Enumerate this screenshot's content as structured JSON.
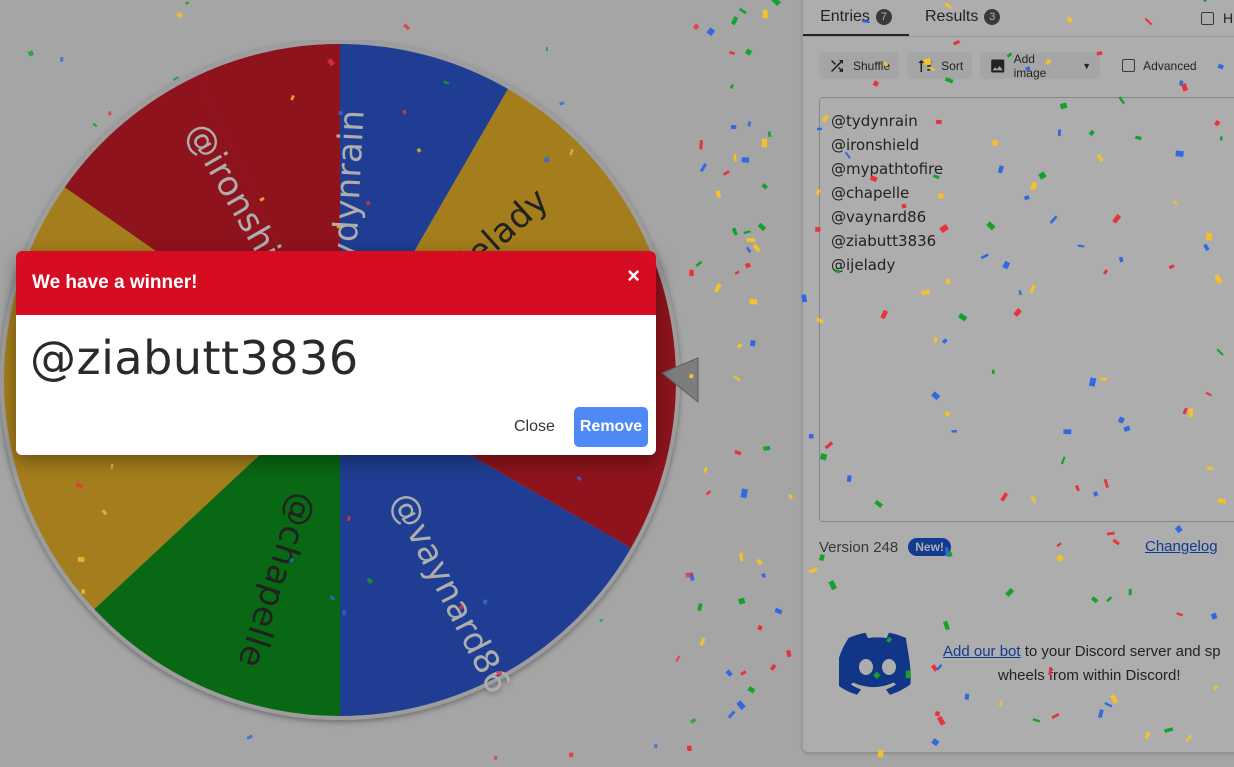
{
  "tabs": [
    {
      "label": "Entries",
      "count": "7"
    },
    {
      "label": "Results",
      "count": "3"
    }
  ],
  "hide_label": "H",
  "toolbar": {
    "shuffle": "Shuffle",
    "sort": "Sort",
    "add_image": "Add image",
    "advanced": "Advanced"
  },
  "entries": [
    "@tydynrain",
    "@ironshield",
    "@mypathtofire",
    "@chapelle",
    "@vaynard86",
    "@ziabutt3836",
    "@ijelady"
  ],
  "wheel": {
    "visible_labels": [
      "@tydynrain",
      "@ijelady",
      "@ironshield",
      "@vaynard86",
      "@chapelle",
      "@z"
    ],
    "colors": {
      "red": "#d21f2c",
      "blue": "#2f5bd9",
      "yellow": "#f2b92a",
      "green": "#0a9a1e"
    }
  },
  "footer": {
    "version": "Version 248",
    "new_badge": "New!",
    "changelog": "Changelog"
  },
  "discord": {
    "link_text": "Add our bot",
    "text_rest": " to your Discord server and sp",
    "line2": "wheels from within Discord!"
  },
  "dialog": {
    "title": "We have a winner!",
    "close_x": "×",
    "winner": "@ziabutt3836",
    "close_button": "Close",
    "remove_button": "Remove"
  }
}
